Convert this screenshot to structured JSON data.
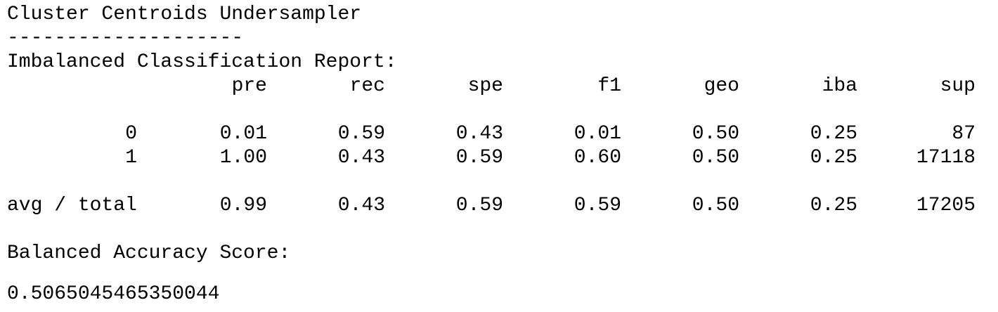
{
  "title": "Cluster Centroids Undersampler",
  "separator": "--------------------",
  "report_heading": "Imbalanced Classification Report:",
  "columns": [
    "pre",
    "rec",
    "spe",
    "f1",
    "geo",
    "iba",
    "sup"
  ],
  "rows": [
    {
      "label": "0",
      "values": [
        "0.01",
        "0.59",
        "0.43",
        "0.01",
        "0.50",
        "0.25",
        "87"
      ]
    },
    {
      "label": "1",
      "values": [
        "1.00",
        "0.43",
        "0.59",
        "0.60",
        "0.50",
        "0.25",
        "17118"
      ]
    }
  ],
  "total_row": {
    "label": "avg / total",
    "values": [
      "0.99",
      "0.43",
      "0.59",
      "0.59",
      "0.50",
      "0.25",
      "17205"
    ]
  },
  "balanced_heading": "Balanced Accuracy Score:",
  "balanced_value": "0.5065045465350044"
}
